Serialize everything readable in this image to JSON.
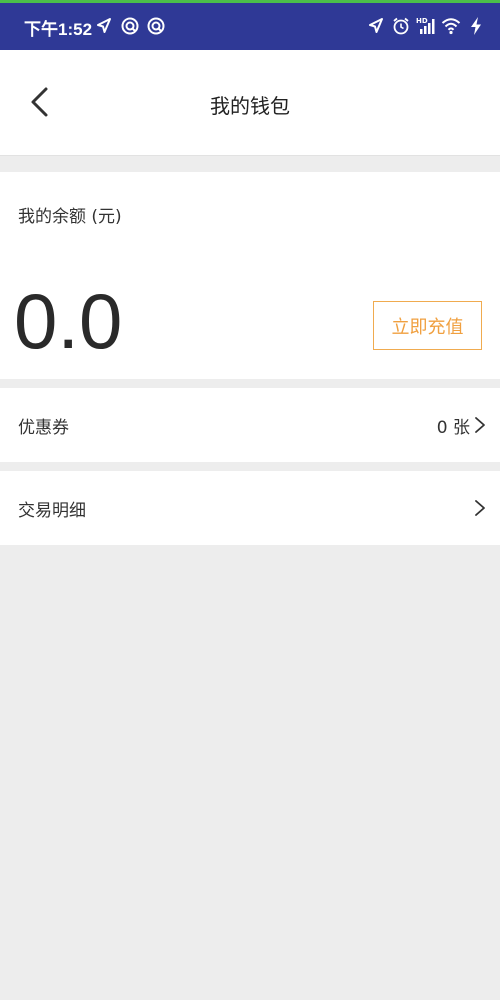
{
  "status_bar": {
    "time": "下午1:52",
    "left_icons": [
      "navigation-icon",
      "app-notification-icon",
      "app-notification-icon"
    ],
    "right_icons": [
      "location-icon",
      "alarm-icon",
      "hd-signal-icon",
      "wifi-icon",
      "charging-icon"
    ],
    "network_label": "HD"
  },
  "header": {
    "title": "我的钱包"
  },
  "balance": {
    "label": "我的余额 (元)",
    "value": "0.0",
    "recharge_label": "立即充值"
  },
  "rows": {
    "coupon": {
      "label": "优惠券",
      "value": "0 张"
    },
    "transactions": {
      "label": "交易明细"
    }
  },
  "colors": {
    "status_bar": "#2f3996",
    "accent": "#f0a040",
    "background": "#ededed"
  }
}
